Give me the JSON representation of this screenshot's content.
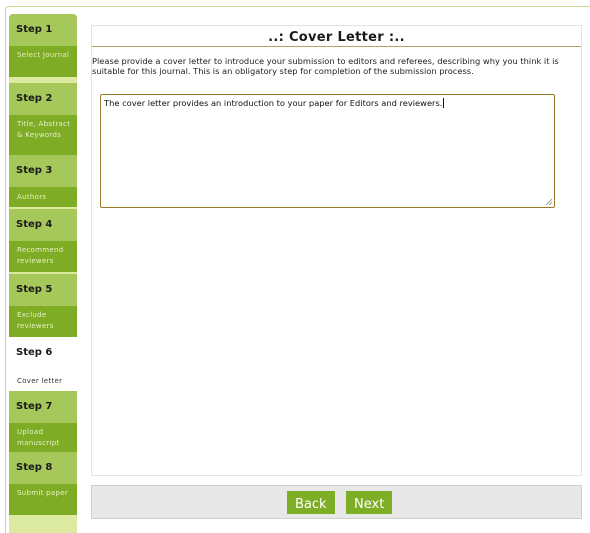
{
  "sidebar": {
    "steps": [
      {
        "step": "Step 1",
        "label": "Select Journal"
      },
      {
        "step": "Step 2",
        "label": "Title, Abstract & Keywords"
      },
      {
        "step": "Step 3",
        "label": "Authors"
      },
      {
        "step": "Step 4",
        "label": "Recommend reviewers"
      },
      {
        "step": "Step 5",
        "label": "Exclude reviewers"
      },
      {
        "step": "Step 6",
        "label": "Cover letter"
      },
      {
        "step": "Step 7",
        "label": "Upload manuscript"
      },
      {
        "step": "Step 8",
        "label": "Submit paper"
      }
    ],
    "active_step": "Step 6"
  },
  "main": {
    "title": "..: Cover Letter :..",
    "intro": "Please provide a cover letter to introduce your submission to editors and referees, describing why you think it is suitable for this journal. This is an obligatory step for completion of the submission process.",
    "cover_letter_value": "The cover letter provides an introduction to your paper for Editors and reviewers."
  },
  "footer": {
    "back_label": "Back",
    "next_label": "Next"
  },
  "colors": {
    "step_header": "#a6c75a",
    "step_desc": "#7eac24",
    "sidebar_bg": "#dce9a1",
    "button": "#7ead26",
    "textarea_border": "#9a7a26"
  }
}
